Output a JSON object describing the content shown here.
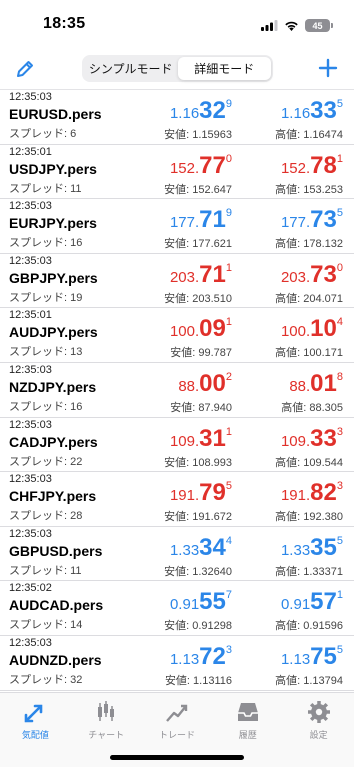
{
  "status": {
    "time": "18:35",
    "battery": "45"
  },
  "nav": {
    "modes": [
      "シンプルモード",
      "詳細モード"
    ],
    "active_mode": 1
  },
  "labels": {
    "low": "安値",
    "high": "高値",
    "spread": "スプレッド"
  },
  "colors": {
    "up": "#2b86e8",
    "down": "#e0302a"
  },
  "quotes": [
    {
      "time": "12:35:03",
      "symbol": "EURUSD.pers",
      "spread": "6",
      "bid": {
        "small": "1.16",
        "big": "32",
        "sup": "9",
        "dir": "up"
      },
      "ask": {
        "small": "1.16",
        "big": "33",
        "sup": "5",
        "dir": "up"
      },
      "low": "1.15963",
      "high": "1.16474"
    },
    {
      "time": "12:35:01",
      "symbol": "USDJPY.pers",
      "spread": "11",
      "bid": {
        "small": "152.",
        "big": "77",
        "sup": "0",
        "dir": "down"
      },
      "ask": {
        "small": "152.",
        "big": "78",
        "sup": "1",
        "dir": "down"
      },
      "low": "152.647",
      "high": "153.253"
    },
    {
      "time": "12:35:03",
      "symbol": "EURJPY.pers",
      "spread": "16",
      "bid": {
        "small": "177.",
        "big": "71",
        "sup": "9",
        "dir": "up"
      },
      "ask": {
        "small": "177.",
        "big": "73",
        "sup": "5",
        "dir": "up"
      },
      "low": "177.621",
      "high": "178.132"
    },
    {
      "time": "12:35:03",
      "symbol": "GBPJPY.pers",
      "spread": "19",
      "bid": {
        "small": "203.",
        "big": "71",
        "sup": "1",
        "dir": "down"
      },
      "ask": {
        "small": "203.",
        "big": "73",
        "sup": "0",
        "dir": "down"
      },
      "low": "203.510",
      "high": "204.071"
    },
    {
      "time": "12:35:01",
      "symbol": "AUDJPY.pers",
      "spread": "13",
      "bid": {
        "small": "100.",
        "big": "09",
        "sup": "1",
        "dir": "down"
      },
      "ask": {
        "small": "100.",
        "big": "10",
        "sup": "4",
        "dir": "down"
      },
      "low": "99.787",
      "high": "100.171"
    },
    {
      "time": "12:35:03",
      "symbol": "NZDJPY.pers",
      "spread": "16",
      "bid": {
        "small": "88.",
        "big": "00",
        "sup": "2",
        "dir": "down"
      },
      "ask": {
        "small": "88.",
        "big": "01",
        "sup": "8",
        "dir": "down"
      },
      "low": "87.940",
      "high": "88.305"
    },
    {
      "time": "12:35:03",
      "symbol": "CADJPY.pers",
      "spread": "22",
      "bid": {
        "small": "109.",
        "big": "31",
        "sup": "1",
        "dir": "down"
      },
      "ask": {
        "small": "109.",
        "big": "33",
        "sup": "3",
        "dir": "down"
      },
      "low": "108.993",
      "high": "109.544"
    },
    {
      "time": "12:35:03",
      "symbol": "CHFJPY.pers",
      "spread": "28",
      "bid": {
        "small": "191.",
        "big": "79",
        "sup": "5",
        "dir": "down"
      },
      "ask": {
        "small": "191.",
        "big": "82",
        "sup": "3",
        "dir": "down"
      },
      "low": "191.672",
      "high": "192.380"
    },
    {
      "time": "12:35:03",
      "symbol": "GBPUSD.pers",
      "spread": "11",
      "bid": {
        "small": "1.33",
        "big": "34",
        "sup": "4",
        "dir": "up"
      },
      "ask": {
        "small": "1.33",
        "big": "35",
        "sup": "5",
        "dir": "up"
      },
      "low": "1.32640",
      "high": "1.33371"
    },
    {
      "time": "12:35:02",
      "symbol": "AUDCAD.pers",
      "spread": "14",
      "bid": {
        "small": "0.91",
        "big": "55",
        "sup": "7",
        "dir": "up"
      },
      "ask": {
        "small": "0.91",
        "big": "57",
        "sup": "1",
        "dir": "up"
      },
      "low": "0.91298",
      "high": "0.91596"
    },
    {
      "time": "12:35:03",
      "symbol": "AUDNZD.pers",
      "spread": "32",
      "bid": {
        "small": "1.13",
        "big": "72",
        "sup": "3",
        "dir": "up"
      },
      "ask": {
        "small": "1.13",
        "big": "75",
        "sup": "5",
        "dir": "up"
      },
      "low": "1.13116",
      "high": "1.13794"
    }
  ],
  "tabs": [
    {
      "label": "気配値",
      "icon": "quotes-arrows-icon",
      "active": true
    },
    {
      "label": "チャート",
      "icon": "candlestick-chart-icon",
      "active": false
    },
    {
      "label": "トレード",
      "icon": "trade-trend-icon",
      "active": false
    },
    {
      "label": "履歴",
      "icon": "history-tray-icon",
      "active": false
    },
    {
      "label": "設定",
      "icon": "settings-gear-icon",
      "active": false
    }
  ]
}
